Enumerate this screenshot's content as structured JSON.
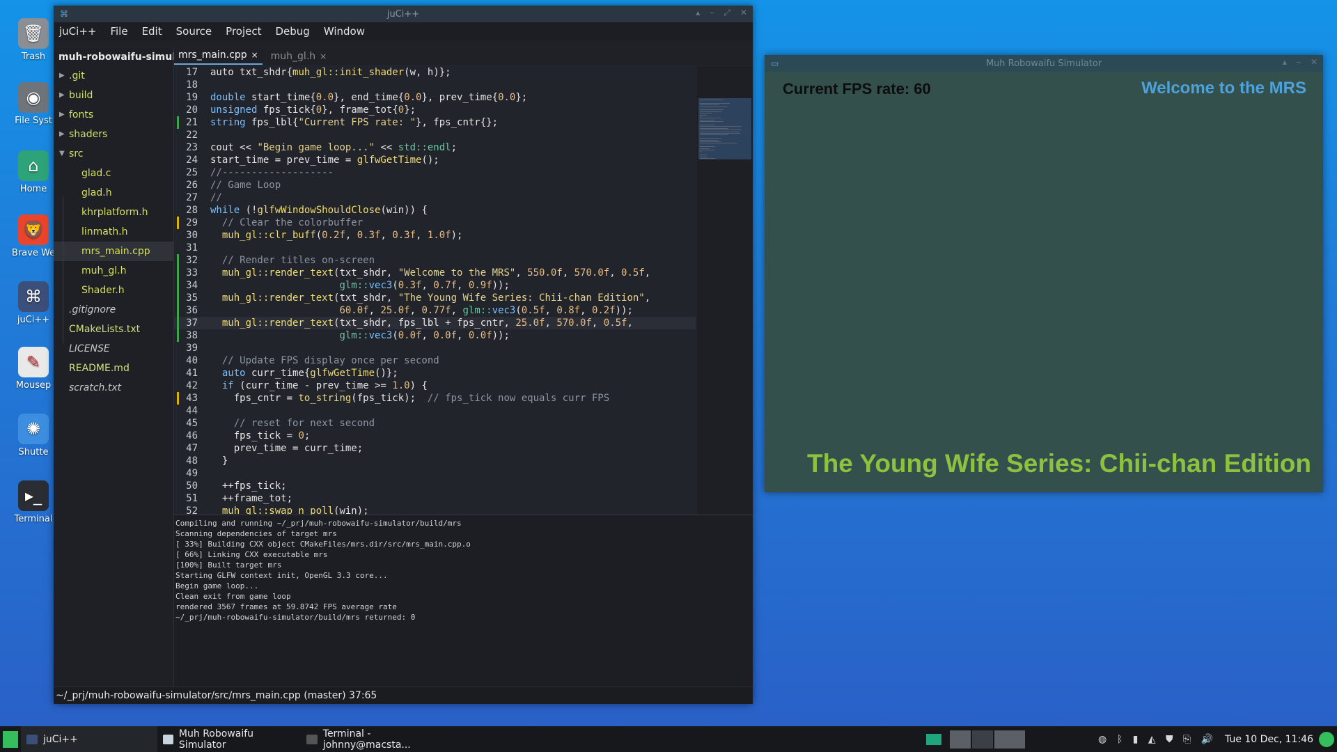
{
  "desktop": {
    "icons": [
      {
        "label": "Trash",
        "icon": "trash-icon"
      },
      {
        "label": "File Syst",
        "icon": "drive-icon"
      },
      {
        "label": "Home",
        "icon": "home-folder-icon"
      },
      {
        "label": "Brave We",
        "icon": "brave-browser-icon"
      },
      {
        "label": "juCi++",
        "icon": "jucipp-icon"
      },
      {
        "label": "Mousep",
        "icon": "mousepad-icon"
      },
      {
        "label": "Shutte",
        "icon": "shutter-icon"
      },
      {
        "label": "Terminal",
        "icon": "terminal-icon"
      }
    ]
  },
  "editor_window": {
    "title": "juCi++",
    "menu": [
      "juCi++",
      "File",
      "Edit",
      "Source",
      "Project",
      "Debug",
      "Window"
    ],
    "project_name": "muh-robowaifu-simulator",
    "tree": {
      "dirs": [
        ".git",
        "build",
        "fonts",
        "shaders",
        "src"
      ],
      "src_files": [
        "glad.c",
        "glad.h",
        "khrplatform.h",
        "linmath.h",
        "mrs_main.cpp",
        "muh_gl.h",
        "Shader.h"
      ],
      "root_files": [
        ".gitignore",
        "CMakeLists.txt",
        "LICENSE",
        "README.md",
        "scratch.txt"
      ]
    },
    "tabs": [
      {
        "label": "mrs_main.cpp",
        "close": "×"
      },
      {
        "label": "muh_gl.h",
        "close": "×"
      }
    ],
    "code_lines": [
      {
        "n": "17",
        "m": "",
        "t": [
          [
            "src",
            "auto txt_shdr{"
          ],
          [
            "fn",
            "muh_gl::init_shader"
          ],
          [
            "src",
            "(w, h)};"
          ]
        ]
      },
      {
        "n": "18",
        "m": "",
        "t": []
      },
      {
        "n": "19",
        "m": "",
        "t": [
          [
            "kw",
            "double"
          ],
          [
            "src",
            " start_time{"
          ],
          [
            "num",
            "0.0"
          ],
          [
            "src",
            "}, end_time{"
          ],
          [
            "num",
            "0.0"
          ],
          [
            "src",
            "}, prev_time{"
          ],
          [
            "num",
            "0.0"
          ],
          [
            "src",
            "};"
          ]
        ]
      },
      {
        "n": "20",
        "m": "",
        "t": [
          [
            "kw",
            "unsigned"
          ],
          [
            "src",
            " fps_tick{"
          ],
          [
            "num",
            "0"
          ],
          [
            "src",
            "}, frame_tot{"
          ],
          [
            "num",
            "0"
          ],
          [
            "src",
            "};"
          ]
        ]
      },
      {
        "n": "21",
        "m": "g",
        "t": [
          [
            "kw",
            "string"
          ],
          [
            "src",
            " fps_lbl{"
          ],
          [
            "str",
            "\"Current FPS rate: \""
          ],
          [
            "src",
            "}, fps_cntr{};"
          ]
        ]
      },
      {
        "n": "22",
        "m": "",
        "t": []
      },
      {
        "n": "23",
        "m": "",
        "t": [
          [
            "src",
            "cout << "
          ],
          [
            "str",
            "\"Begin game loop...\""
          ],
          [
            "src",
            " << "
          ],
          [
            "ns",
            "std::endl"
          ],
          [
            "src",
            ";"
          ]
        ]
      },
      {
        "n": "24",
        "m": "",
        "t": [
          [
            "src",
            "start_time = prev_time = "
          ],
          [
            "fn",
            "glfwGetTime"
          ],
          [
            "src",
            "();"
          ]
        ]
      },
      {
        "n": "25",
        "m": "",
        "t": [
          [
            "cm",
            "//-------------------"
          ]
        ]
      },
      {
        "n": "26",
        "m": "",
        "t": [
          [
            "cm",
            "// Game Loop"
          ]
        ]
      },
      {
        "n": "27",
        "m": "",
        "t": [
          [
            "cm",
            "//"
          ]
        ]
      },
      {
        "n": "28",
        "m": "",
        "t": [
          [
            "kw",
            "while"
          ],
          [
            "src",
            " (!"
          ],
          [
            "fn",
            "glfwWindowShouldClose"
          ],
          [
            "src",
            "(win)) {"
          ]
        ]
      },
      {
        "n": "29",
        "m": "y",
        "t": [
          [
            "cm",
            "  // Clear the colorbuffer"
          ]
        ]
      },
      {
        "n": "30",
        "m": "",
        "t": [
          [
            "src",
            "  "
          ],
          [
            "fn",
            "muh_gl::clr_buff"
          ],
          [
            "src",
            "("
          ],
          [
            "num",
            "0.2f"
          ],
          [
            "src",
            ", "
          ],
          [
            "num",
            "0.3f"
          ],
          [
            "src",
            ", "
          ],
          [
            "num",
            "0.3f"
          ],
          [
            "src",
            ", "
          ],
          [
            "num",
            "1.0f"
          ],
          [
            "src",
            ");"
          ]
        ]
      },
      {
        "n": "31",
        "m": "",
        "t": []
      },
      {
        "n": "32",
        "m": "g",
        "t": [
          [
            "cm",
            "  // Render titles on-screen"
          ]
        ]
      },
      {
        "n": "33",
        "m": "g",
        "t": [
          [
            "src",
            "  "
          ],
          [
            "fn",
            "muh_gl::render_text"
          ],
          [
            "src",
            "(txt_shdr, "
          ],
          [
            "str",
            "\"Welcome to the MRS\""
          ],
          [
            "src",
            ", "
          ],
          [
            "num",
            "550.0f"
          ],
          [
            "src",
            ", "
          ],
          [
            "num",
            "570.0f"
          ],
          [
            "src",
            ", "
          ],
          [
            "num",
            "0.5f"
          ],
          [
            "src",
            ","
          ]
        ]
      },
      {
        "n": "34",
        "m": "g",
        "t": [
          [
            "src",
            "                      "
          ],
          [
            "ns",
            "glm::"
          ],
          [
            "kw",
            "vec3"
          ],
          [
            "src",
            "("
          ],
          [
            "num",
            "0.3f"
          ],
          [
            "src",
            ", "
          ],
          [
            "num",
            "0.7f"
          ],
          [
            "src",
            ", "
          ],
          [
            "num",
            "0.9f"
          ],
          [
            "src",
            "));"
          ]
        ]
      },
      {
        "n": "35",
        "m": "g",
        "t": [
          [
            "src",
            "  "
          ],
          [
            "fn",
            "muh_gl::render_text"
          ],
          [
            "src",
            "(txt_shdr, "
          ],
          [
            "str",
            "\"The Young Wife Series: Chii-chan Edition\""
          ],
          [
            "src",
            ","
          ]
        ]
      },
      {
        "n": "36",
        "m": "g",
        "t": [
          [
            "src",
            "                      "
          ],
          [
            "num",
            "60.0f"
          ],
          [
            "src",
            ", "
          ],
          [
            "num",
            "25.0f"
          ],
          [
            "src",
            ", "
          ],
          [
            "num",
            "0.77f"
          ],
          [
            "src",
            ", "
          ],
          [
            "ns",
            "glm::"
          ],
          [
            "kw",
            "vec3"
          ],
          [
            "src",
            "("
          ],
          [
            "num",
            "0.5f"
          ],
          [
            "src",
            ", "
          ],
          [
            "num",
            "0.8f"
          ],
          [
            "src",
            ", "
          ],
          [
            "num",
            "0.2f"
          ],
          [
            "src",
            "));"
          ]
        ]
      },
      {
        "n": "37",
        "m": "g",
        "cur": true,
        "t": [
          [
            "src",
            "  "
          ],
          [
            "fn",
            "muh_gl::render_text"
          ],
          [
            "src",
            "(txt_shdr, fps_lbl + fps_cntr, "
          ],
          [
            "num",
            "25.0f"
          ],
          [
            "src",
            ", "
          ],
          [
            "num",
            "570.0f"
          ],
          [
            "src",
            ", "
          ],
          [
            "num",
            "0.5f"
          ],
          [
            "src",
            ","
          ]
        ]
      },
      {
        "n": "38",
        "m": "g",
        "t": [
          [
            "src",
            "                      "
          ],
          [
            "ns",
            "glm::"
          ],
          [
            "kw",
            "vec3"
          ],
          [
            "src",
            "("
          ],
          [
            "num",
            "0.0f"
          ],
          [
            "src",
            ", "
          ],
          [
            "num",
            "0.0f"
          ],
          [
            "src",
            ", "
          ],
          [
            "num",
            "0.0f"
          ],
          [
            "src",
            "));"
          ]
        ]
      },
      {
        "n": "39",
        "m": "",
        "t": []
      },
      {
        "n": "40",
        "m": "",
        "t": [
          [
            "cm",
            "  // Update FPS display once per second"
          ]
        ]
      },
      {
        "n": "41",
        "m": "",
        "t": [
          [
            "src",
            "  "
          ],
          [
            "kw",
            "auto"
          ],
          [
            "src",
            " curr_time{"
          ],
          [
            "fn",
            "glfwGetTime"
          ],
          [
            "src",
            "()};"
          ]
        ]
      },
      {
        "n": "42",
        "m": "",
        "t": [
          [
            "src",
            "  "
          ],
          [
            "kw",
            "if"
          ],
          [
            "src",
            " (curr_time - prev_time >= "
          ],
          [
            "num",
            "1.0"
          ],
          [
            "src",
            ") {"
          ]
        ]
      },
      {
        "n": "43",
        "m": "y",
        "t": [
          [
            "src",
            "    fps_cntr = "
          ],
          [
            "fn",
            "to_string"
          ],
          [
            "src",
            "(fps_tick);  "
          ],
          [
            "cm",
            "// fps_tick now equals curr FPS"
          ]
        ]
      },
      {
        "n": "44",
        "m": "",
        "t": []
      },
      {
        "n": "45",
        "m": "",
        "t": [
          [
            "cm",
            "    // reset for next second"
          ]
        ]
      },
      {
        "n": "46",
        "m": "",
        "t": [
          [
            "src",
            "    fps_tick = "
          ],
          [
            "num",
            "0"
          ],
          [
            "src",
            ";"
          ]
        ]
      },
      {
        "n": "47",
        "m": "",
        "t": [
          [
            "src",
            "    prev_time = curr_time;"
          ]
        ]
      },
      {
        "n": "48",
        "m": "",
        "t": [
          [
            "src",
            "  }"
          ]
        ]
      },
      {
        "n": "49",
        "m": "",
        "t": []
      },
      {
        "n": "50",
        "m": "",
        "t": [
          [
            "src",
            "  ++fps_tick;"
          ]
        ]
      },
      {
        "n": "51",
        "m": "",
        "t": [
          [
            "src",
            "  ++frame_tot;"
          ]
        ]
      },
      {
        "n": "52",
        "m": "",
        "t": [
          [
            "src",
            "  "
          ],
          [
            "fn",
            "muh_gl::swap_n_poll"
          ],
          [
            "src",
            "(win);"
          ]
        ]
      }
    ],
    "terminal_lines": [
      "Compiling and running ~/_prj/muh-robowaifu-simulator/build/mrs",
      "Scanning dependencies of target mrs",
      "[ 33%] Building CXX object CMakeFiles/mrs.dir/src/mrs_main.cpp.o",
      "[ 66%] Linking CXX executable mrs",
      "[100%] Built target mrs",
      "Starting GLFW context init, OpenGL 3.3 core...",
      "Begin game loop...",
      "Clean exit from game loop",
      "rendered 3567 frames at 59.8742 FPS average rate",
      "~/_prj/muh-robowaifu-simulator/build/mrs returned: 0"
    ],
    "status": "~/_prj/muh-robowaifu-simulator/src/mrs_main.cpp (master) 37:65"
  },
  "sim_window": {
    "title": "Muh Robowaifu Simulator",
    "fps_text": "Current FPS rate: 60",
    "welcome_text": "Welcome to the MRS",
    "series_text": "The Young Wife Series: Chii-chan Edition",
    "colors": {
      "background": "#34504d",
      "welcome": "#4ea2da",
      "series": "#8cc23f",
      "fps": "#0d0d0d"
    }
  },
  "taskbar": {
    "apps": [
      {
        "label": "juCi++",
        "icon": "jucipp-icon"
      },
      {
        "label": "Muh Robowaifu Simulator",
        "icon": "window-icon"
      },
      {
        "label": "Terminal - johnny@macsta...",
        "icon": "terminal-icon"
      }
    ],
    "clock": "Tue 10 Dec, 11:46"
  }
}
